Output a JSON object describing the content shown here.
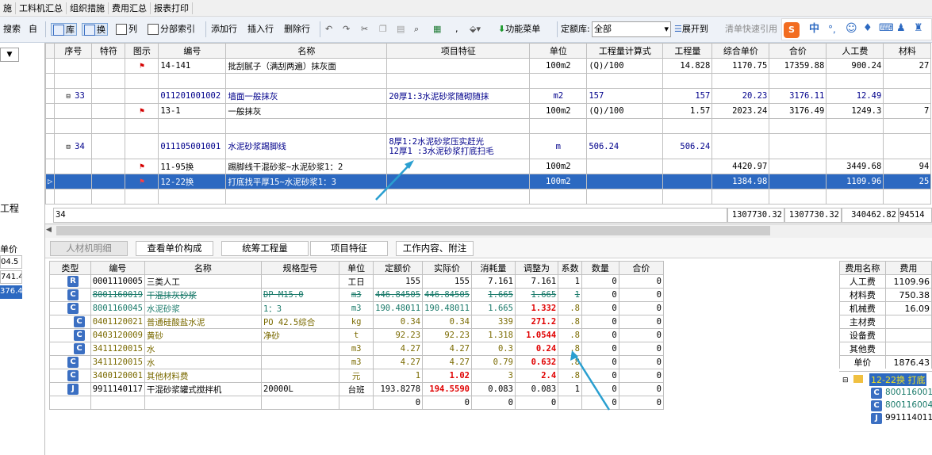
{
  "menu": [
    "施",
    "工料机汇总",
    "组织措施",
    "费用汇总",
    "报表打印"
  ],
  "toolbar": {
    "search": "搜索",
    "left_cut": "自",
    "lib": "库",
    "swap": "换",
    "col": "列",
    "partindex": "分部索引",
    "addrow": "添加行",
    "insertrow": "插入行",
    "delrow": "删除行",
    "funcmenu": "功能菜单",
    "quota_label": "定额库:",
    "quota_value": "全部",
    "expand": "展开到",
    "clear": "清单快速引用",
    "ime": [
      "中",
      "°,"
    ]
  },
  "left": {
    "dropdown_arrow": "▼",
    "item_label": "工程",
    "unit_price": "单价",
    "values": [
      "04.5",
      "741.4",
      "376.4"
    ]
  },
  "upper": {
    "headers": [
      "序号",
      "特符",
      "图示",
      "编号",
      "名称",
      "项目特征",
      "单位",
      "工程量计算式",
      "工程量",
      "综合单价",
      "合价",
      "人工费",
      "材料"
    ],
    "rows": [
      {
        "seq": "",
        "flag": true,
        "code": "14-141",
        "name": "批刮腻子（满刮两遍）抹灰面",
        "feature": "",
        "unit": "100m2",
        "formula": "(Q)/100",
        "qty": "14.828",
        "price": "1170.75",
        "total": "17359.88",
        "labor": "900.24",
        "mat": "27"
      },
      {
        "seq": "",
        "flag": false,
        "code": "",
        "name": "",
        "feature": "",
        "unit": "",
        "formula": "",
        "qty": "",
        "price": "",
        "total": "",
        "labor": "",
        "mat": ""
      },
      {
        "seq": "33",
        "flag": false,
        "code": "011201001002",
        "name": "墙面一般抹灰",
        "feature": "20厚1:3水泥砂浆随砌随抹",
        "unit": "m2",
        "formula": "157",
        "qty": "157",
        "price": "20.23",
        "total": "3176.11",
        "labor": "12.49",
        "mat": ""
      },
      {
        "seq": "",
        "flag": true,
        "code": "13-1",
        "name": "一般抹灰",
        "feature": "",
        "unit": "100m2",
        "formula": "(Q)/100",
        "qty": "1.57",
        "price": "2023.24",
        "total": "3176.49",
        "labor": "1249.3",
        "mat": "7"
      },
      {
        "seq": "",
        "flag": false,
        "code": "",
        "name": "",
        "feature": "",
        "unit": "",
        "formula": "",
        "qty": "",
        "price": "",
        "total": "",
        "labor": "",
        "mat": ""
      },
      {
        "seq": "34",
        "flag": false,
        "code": "011105001001",
        "name": "水泥砂浆踢脚线",
        "feature": "8厚1:2水泥砂浆压实赶光",
        "feature2": "12厚1 :3水泥砂浆打底扫毛",
        "unit": "m",
        "formula": "506.24",
        "qty": "506.24",
        "price": "",
        "total": "",
        "labor": "",
        "mat": ""
      },
      {
        "seq": "",
        "flag": true,
        "code": "11-95换",
        "name": "踢脚线干混砂浆~水泥砂浆1：2",
        "feature": "",
        "unit": "100m2",
        "formula": "",
        "qty": "",
        "price": "4420.97",
        "total": "",
        "labor": "3449.68",
        "mat": "94"
      },
      {
        "seq": "",
        "flag": true,
        "code": "12-22换",
        "name": "打底找平厚15~水泥砂浆1：3",
        "feature": "",
        "unit": "100m2",
        "formula": "",
        "qty": "",
        "price": "1384.98",
        "total": "",
        "labor": "1109.96",
        "mat": "25"
      },
      {
        "seq": "",
        "flag": false,
        "code": "",
        "name": "",
        "feature": "",
        "unit": "",
        "formula": "",
        "qty": "",
        "price": "",
        "total": "",
        "labor": "",
        "mat": ""
      }
    ],
    "footer": {
      "seq": "34",
      "price": "1307730.32",
      "total": "1307730.32",
      "labor": "340462.82",
      "mat": "94514"
    }
  },
  "tabs": [
    "人材机明细",
    "查看单价构成",
    "统筹工程量",
    "项目特征",
    "工作内容、附注"
  ],
  "lower": {
    "headers": [
      "类型",
      "编号",
      "名称",
      "规格型号",
      "单位",
      "定额价",
      "实际价",
      "消耗量",
      "调整为",
      "系数",
      "数量",
      "合价"
    ],
    "rows": [
      {
        "type": "R",
        "code": "0001110005",
        "name": "三类人工",
        "spec": "",
        "unit": "工日",
        "quota": "155",
        "actual": "155",
        "consume": "7.161",
        "adjust": "7.161",
        "coef": "1",
        "num": "0",
        "sum": "0",
        "style": "",
        "indent": 0
      },
      {
        "type": "C",
        "code": "8001160019",
        "name": "干混抹灰砂浆",
        "spec": "DP M15.0",
        "unit": "m3",
        "quota": "446.84505",
        "actual": "446.84505",
        "consume": "1.665",
        "adjust": "1.665",
        "coef": "1",
        "num": "0",
        "sum": "0",
        "style": "strike",
        "indent": 0
      },
      {
        "type": "C",
        "code": "8001160045",
        "name": "水泥砂浆",
        "spec": "1：3",
        "unit": "m3",
        "quota": "190.48011",
        "actual": "190.48011",
        "consume": "1.665",
        "adjust": "1.332",
        "coef": ".8",
        "num": "0",
        "sum": "0",
        "style": "teal",
        "indent": 0
      },
      {
        "type": "C",
        "code": "0401120021",
        "name": "普通硅酸盐水泥",
        "spec": "PO 42.5综合",
        "unit": "kg",
        "quota": "0.34",
        "actual": "0.34",
        "consume": "339",
        "adjust": "271.2",
        "coef": ".8",
        "num": "0",
        "sum": "0",
        "style": "olive",
        "indent": 1
      },
      {
        "type": "C",
        "code": "0403120009",
        "name": "黄砂",
        "spec": "净砂",
        "unit": "t",
        "quota": "92.23",
        "actual": "92.23",
        "consume": "1.318",
        "adjust": "1.0544",
        "coef": ".8",
        "num": "0",
        "sum": "0",
        "style": "olive",
        "indent": 1
      },
      {
        "type": "C",
        "code": "3411120015",
        "name": "水",
        "spec": "",
        "unit": "m3",
        "quota": "4.27",
        "actual": "4.27",
        "consume": "0.3",
        "adjust": "0.24",
        "coef": ".8",
        "num": "0",
        "sum": "0",
        "style": "olive",
        "indent": 1
      },
      {
        "type": "C",
        "code": "3411120015",
        "name": "水",
        "spec": "",
        "unit": "m3",
        "quota": "4.27",
        "actual": "4.27",
        "consume": "0.79",
        "adjust": "0.632",
        "coef": ".8",
        "num": "0",
        "sum": "0",
        "style": "olive",
        "indent": 0
      },
      {
        "type": "C",
        "code": "3400120001",
        "name": "其他材料费",
        "spec": "",
        "unit": "元",
        "quota": "1",
        "actual": "1.02",
        "consume": "3",
        "adjust": "2.4",
        "coef": ".8",
        "num": "0",
        "sum": "0",
        "style": "olive",
        "indent": 0
      },
      {
        "type": "J",
        "code": "9911140117",
        "name": "干混砂浆罐式搅拌机",
        "spec": "20000L",
        "unit": "台班",
        "quota": "193.8278",
        "actual": "194.5590",
        "consume": "0.083",
        "adjust": "0.083",
        "coef": "1",
        "num": "0",
        "sum": "0",
        "style": "",
        "indent": 0
      },
      {
        "type": "",
        "code": "",
        "name": "",
        "spec": "",
        "unit": "",
        "quota": "0",
        "actual": "0",
        "consume": "0",
        "adjust": "0",
        "coef": "",
        "num": "0",
        "sum": "0",
        "style": "",
        "indent": 0
      }
    ]
  },
  "fees": {
    "headers": [
      "费用名称",
      "费用"
    ],
    "rows": [
      [
        "人工费",
        "1109.96"
      ],
      [
        "材料费",
        "750.38"
      ],
      [
        "机械费",
        "16.09"
      ],
      [
        "主材费",
        ""
      ],
      [
        "设备费",
        ""
      ],
      [
        "其他费",
        ""
      ],
      [
        "单价",
        "1876.43"
      ]
    ]
  },
  "tree": {
    "root": "12-22换 打底",
    "items": [
      "8001160019",
      "8001160045",
      "9911140117"
    ]
  }
}
